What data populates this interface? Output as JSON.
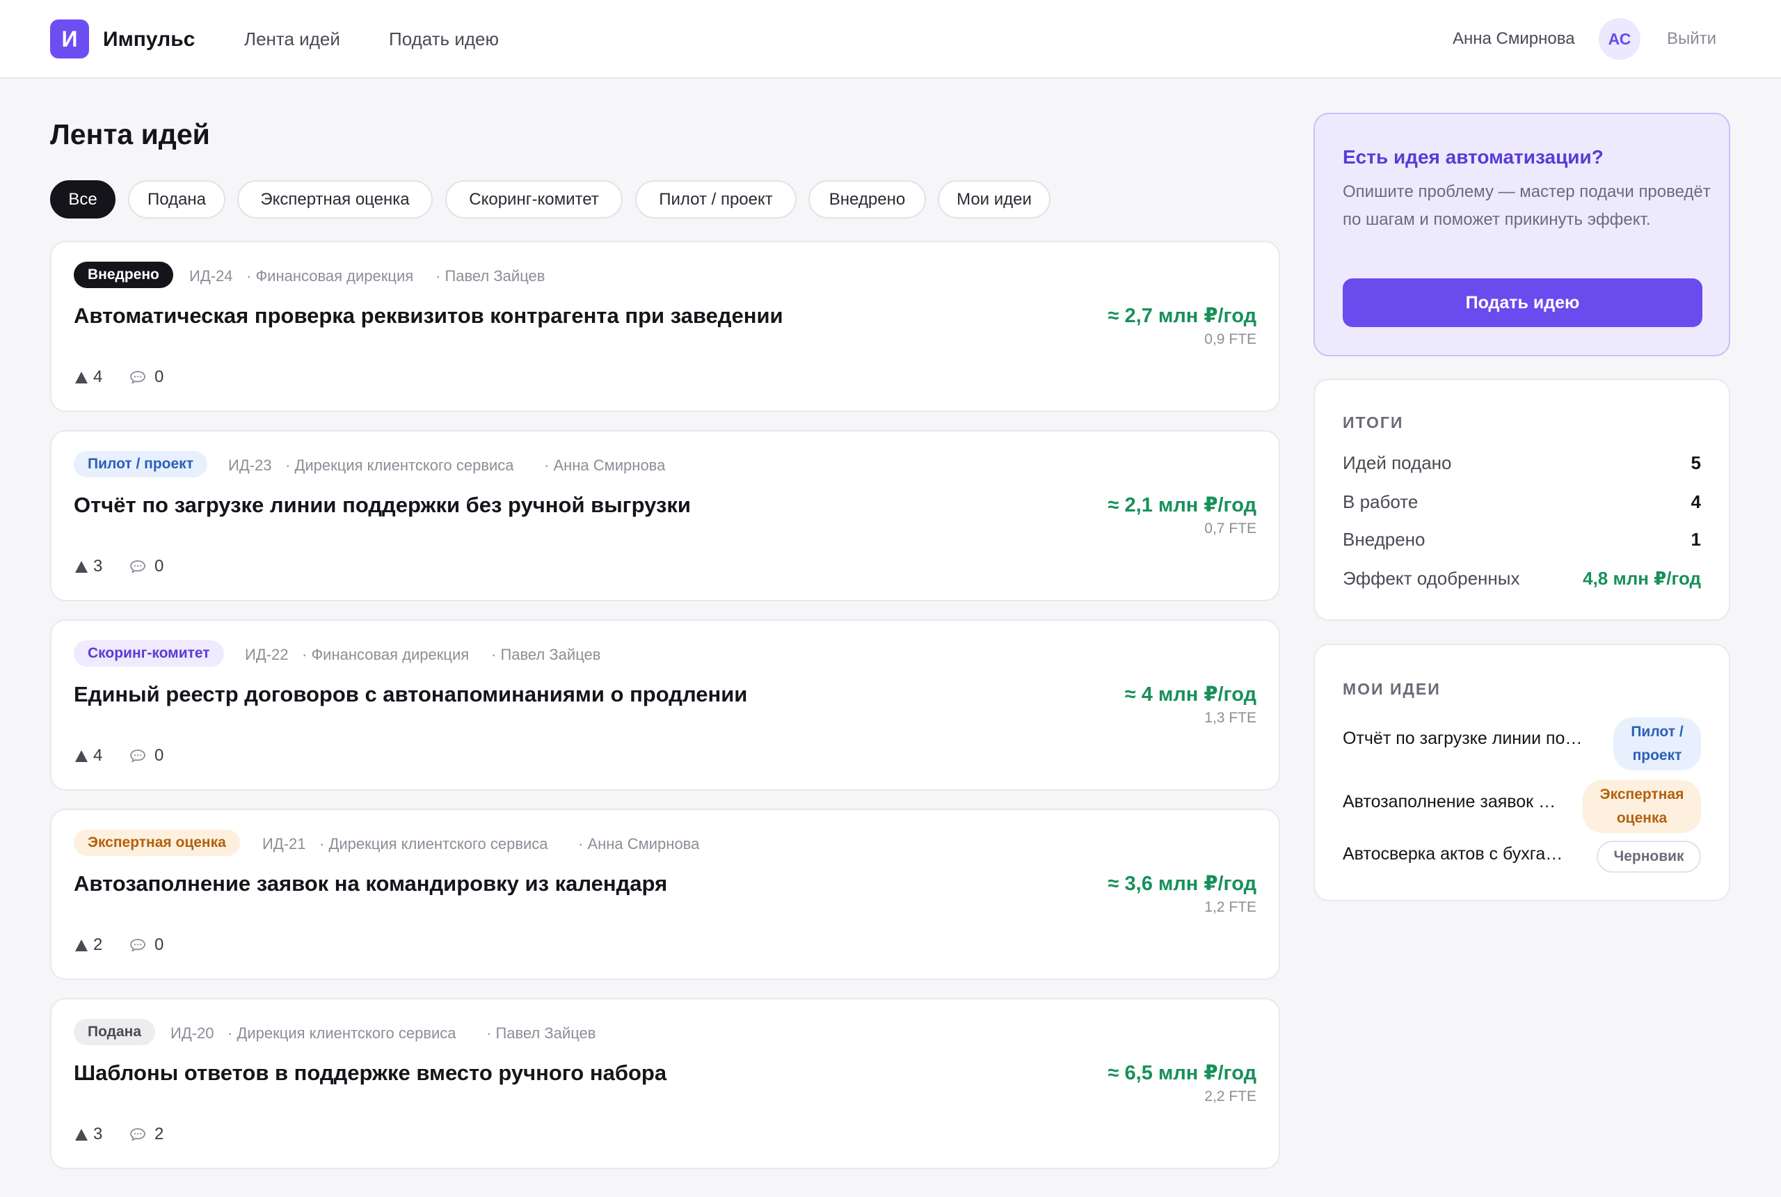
{
  "header": {
    "logo_letter": "И",
    "brand": "Импульс",
    "nav": [
      "Лента идей",
      "Подать идею"
    ],
    "user_name": "Анна Смирнова",
    "avatar_initials": "АС",
    "logout": "Выйти"
  },
  "page_title": "Лента идей",
  "filters": [
    "Все",
    "Подана",
    "Экспертная оценка",
    "Скоринг-комитет",
    "Пилот / проект",
    "Внедрено",
    "Мои идеи"
  ],
  "active_filter": "Все",
  "ideas": [
    {
      "status": "Внедрено",
      "id": "ИД-24",
      "department": "· Финансовая дирекция",
      "author": "· Павел Зайцев",
      "title": "Автоматическая проверка реквизитов контрагента при заведении",
      "effect": "≈ 2,7 млн ₽/год",
      "fte": "0,9 FTE",
      "votes": "4",
      "comments": "0"
    },
    {
      "status": "Пилот / проект",
      "id": "ИД-23",
      "department": "· Дирекция клиентского сервиса",
      "author": "· Анна Смирнова",
      "title": "Отчёт по загрузке линии поддержки без ручной выгрузки",
      "effect": "≈ 2,1 млн ₽/год",
      "fte": "0,7 FTE",
      "votes": "3",
      "comments": "0"
    },
    {
      "status": "Скоринг-комитет",
      "id": "ИД-22",
      "department": "· Финансовая дирекция",
      "author": "· Павел Зайцев",
      "title": "Единый реестр договоров с автонапоминаниями о продлении",
      "effect": "≈ 4 млн ₽/год",
      "fte": "1,3 FTE",
      "votes": "4",
      "comments": "0"
    },
    {
      "status": "Экспертная оценка",
      "id": "ИД-21",
      "department": "· Дирекция клиентского сервиса",
      "author": "· Анна Смирнова",
      "title": "Автозаполнение заявок на командировку из календаря",
      "effect": "≈ 3,6 млн ₽/год",
      "fte": "1,2 FTE",
      "votes": "2",
      "comments": "0"
    },
    {
      "status": "Подана",
      "id": "ИД-20",
      "department": "· Дирекция клиентского сервиса",
      "author": "· Павел Зайцев",
      "title": "Шаблоны ответов в поддержке вместо ручного набора",
      "effect": "≈ 6,5 млн ₽/год",
      "fte": "2,2 FTE",
      "votes": "3",
      "comments": "2"
    }
  ],
  "cta": {
    "title": "Есть идея автоматизации?",
    "text": "Опишите проблему — мастер подачи проведёт по шагам и поможет прикинуть эффект.",
    "button": "Подать идею"
  },
  "totals": {
    "heading": "ИТОГИ",
    "rows": [
      {
        "label": "Идей подано",
        "value": "5"
      },
      {
        "label": "В работе",
        "value": "4"
      },
      {
        "label": "Внедрено",
        "value": "1"
      },
      {
        "label": "Эффект одобренных",
        "value": "4,8 млн ₽/год"
      }
    ]
  },
  "my_ideas": {
    "heading": "МОИ ИДЕИ",
    "items": [
      {
        "title": "Отчёт по загрузке линии по…",
        "status": "Пилот / проект"
      },
      {
        "title": "Автозаполнение заявок …",
        "status": "Экспертная оценка"
      },
      {
        "title": "Автосверка актов с бухга…",
        "status": "Черновик"
      }
    ]
  },
  "colors": {
    "accent": "#6d4ef2",
    "effect_green": "#17905a",
    "background": "#f6f6f8"
  },
  "icons": [
    "vote-up-icon",
    "comment-icon"
  ]
}
